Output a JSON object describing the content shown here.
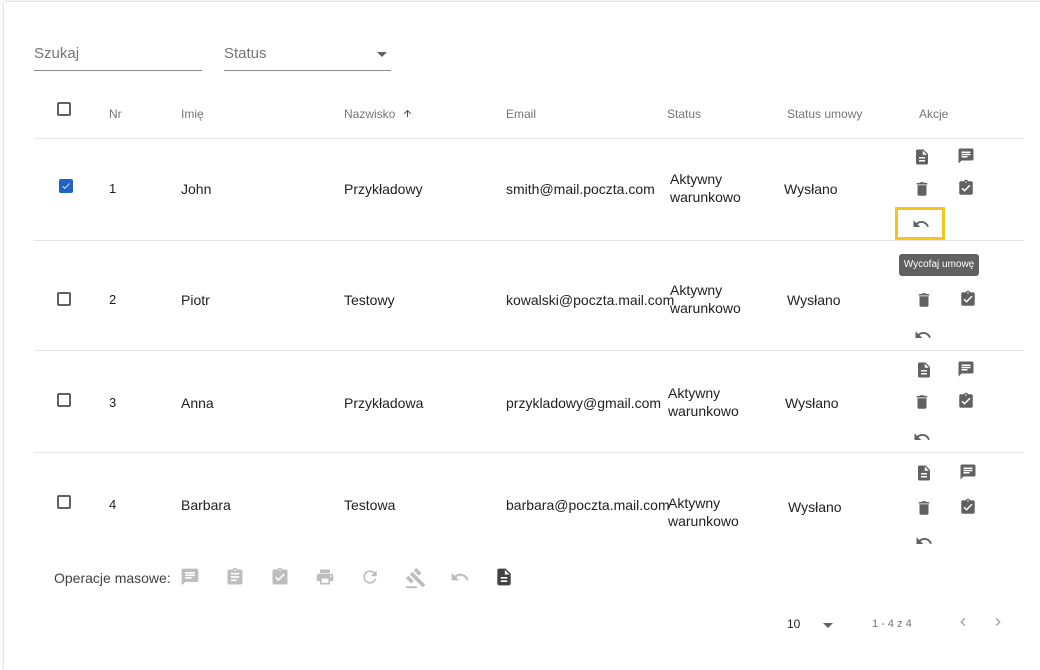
{
  "filters": {
    "search_placeholder": "Szukaj",
    "status_label": "Status"
  },
  "table": {
    "headers": {
      "nr": "Nr",
      "first_name": "Imię",
      "last_name": "Nazwisko",
      "email": "Email",
      "status": "Status",
      "contract_status": "Status umowy",
      "actions": "Akcje"
    },
    "sort_icon": "arrow-up-icon",
    "rows": [
      {
        "nr": "1",
        "first_name": "John",
        "last_name": "Przykładowy",
        "email": "smith@mail.poczta.com",
        "status_line1": "Aktywny",
        "status_line2": "warunkowo",
        "contract_status": "Wysłano",
        "checked": true
      },
      {
        "nr": "2",
        "first_name": "Piotr",
        "last_name": "Testowy",
        "email": "kowalski@poczta.mail.com",
        "status_line1": "Aktywny",
        "status_line2": "warunkowo",
        "contract_status": "Wysłano",
        "checked": false
      },
      {
        "nr": "3",
        "first_name": "Anna",
        "last_name": "Przykładowa",
        "email": "przykladowy@gmail.com",
        "status_line1": "Aktywny",
        "status_line2": "warunkowo",
        "contract_status": "Wysłano",
        "checked": false
      },
      {
        "nr": "4",
        "first_name": "Barbara",
        "last_name": "Testowa",
        "email": "barbara@poczta.mail.com",
        "status_line1": "Aktywny",
        "status_line2": "warunkowo",
        "contract_status": "Wysłano",
        "checked": false
      }
    ]
  },
  "tooltip": {
    "text": "Wycofaj umowę"
  },
  "bulk": {
    "label": "Operacje masowe:",
    "icons": [
      "comment-icon",
      "clipboard-icon",
      "clipboard-check-icon",
      "print-icon",
      "refresh-icon",
      "gavel-icon",
      "undo-icon",
      "document-icon"
    ]
  },
  "pagination": {
    "page_size": "10",
    "range": "1 - 4 z 4"
  },
  "colors": {
    "checkbox_checked": "#1e63c8",
    "highlight": "#f5c518",
    "icon": "#616161",
    "icon_disabled": "#bdbdbd"
  }
}
